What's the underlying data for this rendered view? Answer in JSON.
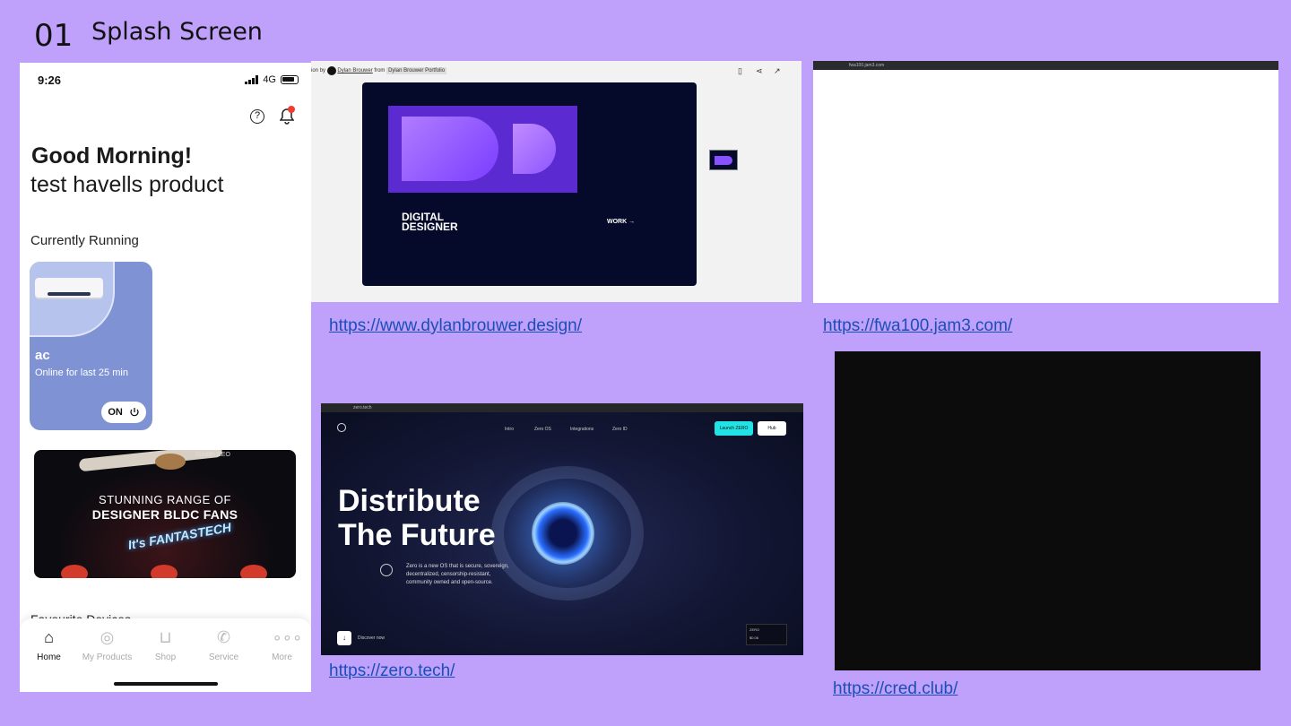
{
  "slide": {
    "number": "01",
    "title": "Splash Screen"
  },
  "phone": {
    "status": {
      "time": "9:26",
      "network": "4G"
    },
    "greeting": "Good Morning!",
    "user_name": "test havells product",
    "section_running": "Currently Running",
    "device": {
      "name": "ac",
      "status": "Online for last 25 min",
      "power": "ON"
    },
    "banner": {
      "brand": "Stealth NEO",
      "line1": "STUNNING RANGE OF",
      "line2": "DESIGNER BLDC FANS",
      "line3": "It's FANTASTECH"
    },
    "section_favourites": "Favourite Devices",
    "tabs": [
      {
        "label": "Home",
        "icon": "home-icon"
      },
      {
        "label": "My Products",
        "icon": "plug-icon"
      },
      {
        "label": "Shop",
        "icon": "cart-icon"
      },
      {
        "label": "Service",
        "icon": "phone-icon"
      },
      {
        "label": "More",
        "icon": "more-icon"
      }
    ]
  },
  "shot_dylan": {
    "toolbar": {
      "prefix": "ion",
      "by": "by",
      "author": "Dylan Brouwer",
      "from": "from",
      "collection": "Dylan Brouwer Portfolio"
    },
    "headline": "DIGITAL DESIGNER",
    "cta": "WORK →",
    "link": "https://www.dylanbrouwer.design/"
  },
  "shot_fwa": {
    "url_bar": "fwa100.jam3.com",
    "link": "https://fwa100.jam3.com/"
  },
  "shot_zero": {
    "url_bar": "zero.tech",
    "nav": [
      "Intro",
      "Zero OS",
      "Integrations",
      "Zero ID"
    ],
    "launch": "Launch ZERO",
    "hub": "Hub",
    "headline_1": "Distribute",
    "headline_2": "The Future",
    "description": "Zero is a new OS that is secure, sovereign, decentralized, censorship-resistant, community owned and open-source.",
    "discover": "Discover now",
    "ticker_name": "ZERO",
    "ticker_value": "$0.06",
    "link": "https://zero.tech/"
  },
  "shot_cred": {
    "link": "https://cred.club/"
  }
}
